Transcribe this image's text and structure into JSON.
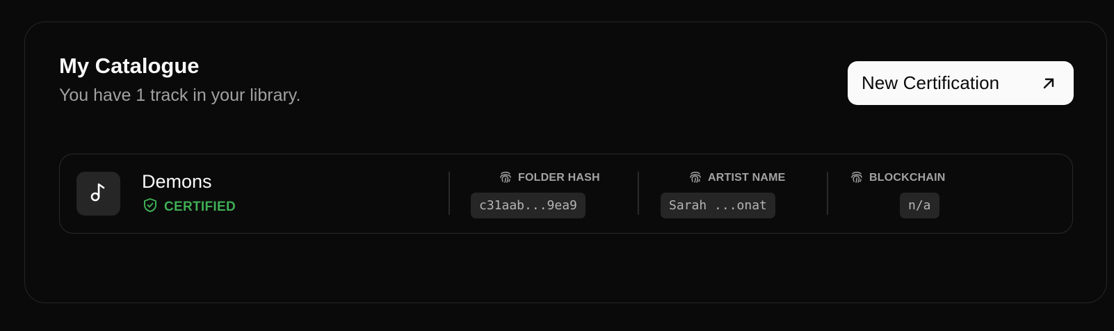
{
  "catalogue": {
    "title": "My Catalogue",
    "subtitle": "You have 1 track in your library.",
    "new_button_label": "New Certification",
    "new_button_icon": "arrow-up-right-icon"
  },
  "tracks": [
    {
      "name": "Demons",
      "icon": "music-note-icon",
      "status": "CERTIFIED",
      "status_icon": "shield-check-icon",
      "status_color": "#3fae55",
      "folder_hash_label": "FOLDER HASH",
      "folder_hash_value": "c31aab...9ea9",
      "artist_name_label": "ARTIST NAME",
      "artist_name_value": "Sarah ...onat",
      "blockchain_label": "BLOCKCHAIN",
      "blockchain_value": "n/a",
      "meta_icon": "fingerprint-icon"
    }
  ],
  "colors": {
    "background": "#0a0a0a",
    "border": "#262626",
    "button_bg": "#fafafa",
    "muted_text": "#a1a1a1",
    "chip_bg": "#262626"
  }
}
